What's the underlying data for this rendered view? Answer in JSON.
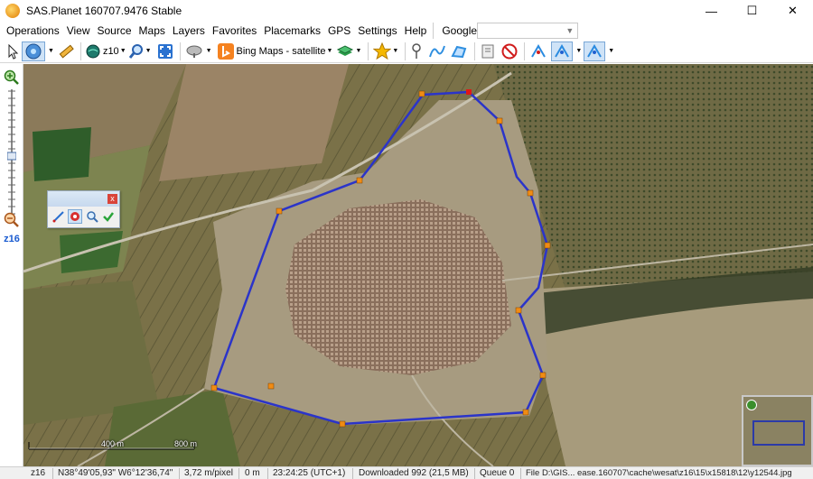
{
  "window": {
    "title": "SAS.Planet 160707.9476 Stable",
    "minimize": "—",
    "maximize": "☐",
    "close": "✕"
  },
  "menu": {
    "items": [
      "Operations",
      "View",
      "Source",
      "Maps",
      "Layers",
      "Favorites",
      "Placemarks",
      "GPS",
      "Settings",
      "Help"
    ],
    "search_provider": "Google"
  },
  "toolbar": {
    "zoom_level": "z10",
    "map_source": "Bing Maps - satellite"
  },
  "left_panel": {
    "zoom_label": "z16"
  },
  "scale": {
    "label_1": "400 m",
    "label_2": "800 m"
  },
  "status": {
    "zoom": "z16",
    "coords": "N38°49'05,93\" W6°12'36,74\"",
    "resolution": "3,72 m/pixel",
    "altitude": "0 m",
    "time": "23:24:25 (UTC+1)",
    "downloaded": "Downloaded 992 (21,5 MB)",
    "queue": "Queue 0",
    "file": "File D:\\GIS... ease.160707\\cache\\wesat\\z16\\15\\x15818\\12\\y12544.jpg"
  },
  "colors": {
    "polygon_line": "#2b34c9",
    "polygon_vertex": "#f08c14",
    "polygon_vertex_active": "#e01818",
    "accent": "#1a5bd0"
  }
}
